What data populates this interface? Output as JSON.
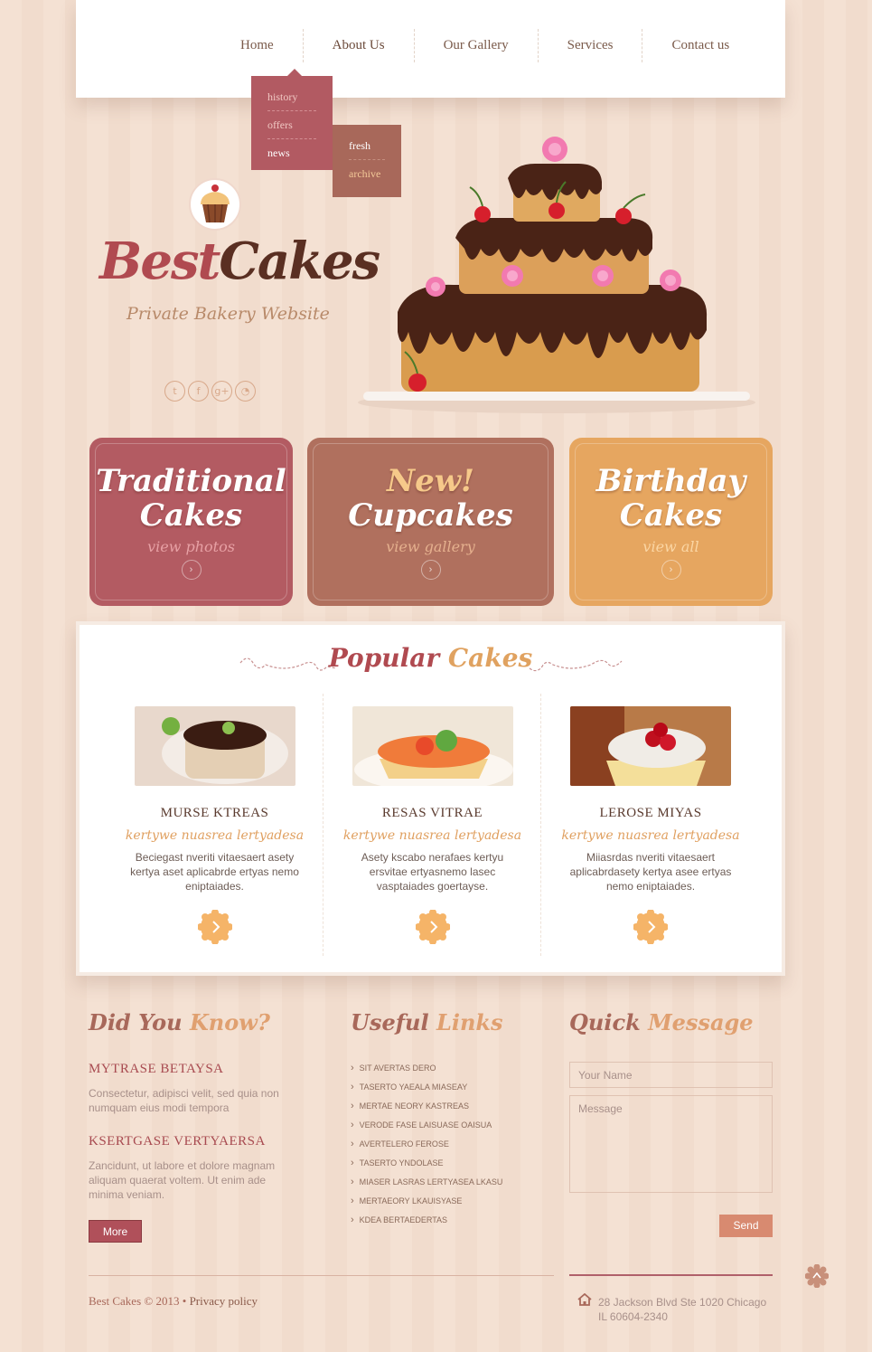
{
  "nav": {
    "items": [
      {
        "label": "Home"
      },
      {
        "label": "About Us"
      },
      {
        "label": "Our Gallery"
      },
      {
        "label": "Services"
      },
      {
        "label": "Contact us"
      }
    ],
    "dropdown": [
      "history",
      "offers",
      "news"
    ],
    "subdropdown": [
      "fresh",
      "archive"
    ]
  },
  "brand": {
    "name_part1": "Best",
    "name_part2": "Cakes",
    "tagline": "Private Bakery Website",
    "social_icons": [
      "twitter-icon",
      "facebook-icon",
      "google-plus-icon",
      "rss-icon"
    ]
  },
  "banners": [
    {
      "title1": "Traditional",
      "title2": "Cakes",
      "sub": "view photos"
    },
    {
      "title1": "New!",
      "title2": "Cupcakes",
      "sub": "view gallery"
    },
    {
      "title1": "Birthday",
      "title2": "Cakes",
      "sub": "view all"
    }
  ],
  "popular": {
    "title_a": "Popular",
    "title_b": "Cakes",
    "items": [
      {
        "name": "MURSE KTREAS",
        "script": "kertywe nuasrea lertyadesa",
        "desc": "Beciegast nveriti vitaesaert asety kertya aset aplicabrde ertyas nemo eniptaiades."
      },
      {
        "name": "RESAS VITRAE",
        "script": "kertywe nuasrea lertyadesa",
        "desc": "Asety kscabo nerafaes kertyu ersvitae ertyasnemo lasec vasptaiades goertayse."
      },
      {
        "name": "LEROSE MIYAS",
        "script": "kertywe nuasrea lertyadesa",
        "desc": "Miiasrdas nveriti vitaesaert aplicabrdasety kertya asee ertyas nemo eniptaiades."
      }
    ]
  },
  "know": {
    "title_a": "Did You",
    "title_b": "Know?",
    "heading1": "MYTRASE BETAYSA",
    "text1": "Consectetur, adipisci velit, sed quia non numquam eius modi tempora",
    "heading2": "KSERTGASE VERTYAERSA",
    "text2": "Zancidunt, ut labore et dolore magnam aliquam quaerat voltem. Ut enim ade minima veniam.",
    "more": "More"
  },
  "useful": {
    "title_a": "Useful",
    "title_b": "Links",
    "links": [
      "SIT AVERTAS DERO",
      "TASERTO YAEALA MIASEAY",
      "MERTAE NEORY KASTREAS",
      "VERODE FASE LAISUASE OAISUA",
      "AVERTELERO FEROSE",
      "TASERTO YNDOLASE",
      "MIASER LASRAS LERTYASEA LKASU",
      "MERTAEORY LKAUISYASE",
      "KDEA BERTAEDERTAS"
    ]
  },
  "quick": {
    "title_a": "Quick",
    "title_b": "Message",
    "name_placeholder": "Your Name",
    "message_placeholder": "Message",
    "send": "Send"
  },
  "footer": {
    "copyright": "Best Cakes © 2013 •",
    "privacy": "Privacy policy",
    "address": "28 Jackson Blvd Ste 1020 Chicago IL 60604-2340"
  },
  "colors": {
    "accent_red": "#b04a50",
    "accent_brown": "#5a2f22",
    "accent_orange": "#e0a260"
  }
}
